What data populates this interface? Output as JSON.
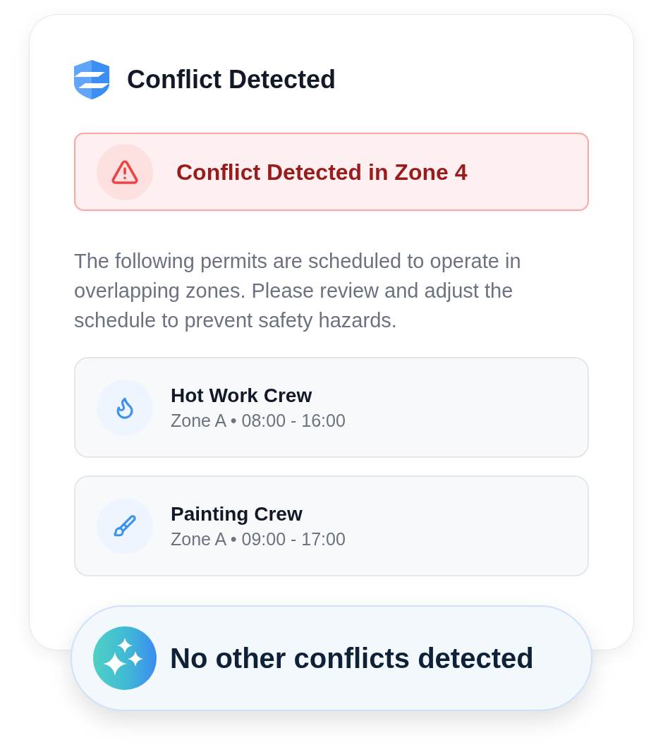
{
  "header": {
    "title": "Conflict Detected"
  },
  "alert": {
    "title": "Conflict Detected in Zone 4"
  },
  "description": "The following permits are scheduled to operate in overlapping zones. Please review and adjust the schedule to prevent safety hazards.",
  "permits": [
    {
      "kind": "hotwork",
      "name": "Hot Work Crew",
      "details": "Zone A • 08:00 - 16:00"
    },
    {
      "kind": "painting",
      "name": "Painting Crew",
      "details": "Zone A • 09:00 - 17:00"
    }
  ],
  "status": {
    "text": "No other conflicts detected"
  }
}
